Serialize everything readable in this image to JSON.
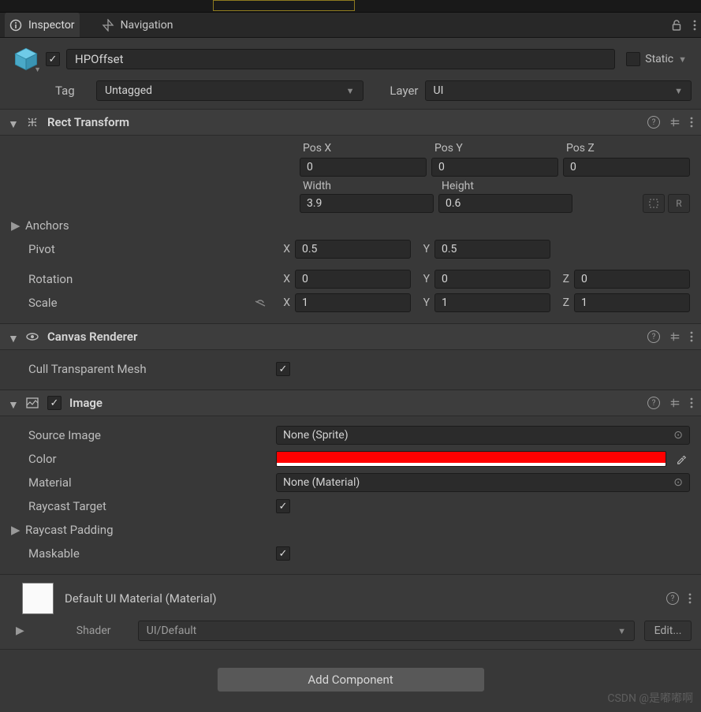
{
  "tabs": {
    "inspector": "Inspector",
    "navigation": "Navigation"
  },
  "header": {
    "name": "HPOffset",
    "enabled": true,
    "static_label": "Static",
    "static_checked": false,
    "tag_label": "Tag",
    "tag_value": "Untagged",
    "layer_label": "Layer",
    "layer_value": "UI"
  },
  "rect_transform": {
    "title": "Rect Transform",
    "posx_label": "Pos X",
    "posx": "0",
    "posy_label": "Pos Y",
    "posy": "0",
    "posz_label": "Pos Z",
    "posz": "0",
    "width_label": "Width",
    "width": "3.9",
    "height_label": "Height",
    "height": "0.6",
    "anchors_label": "Anchors",
    "pivot_label": "Pivot",
    "pivot_x": "0.5",
    "pivot_y": "0.5",
    "rotation_label": "Rotation",
    "rot_x": "0",
    "rot_y": "0",
    "rot_z": "0",
    "scale_label": "Scale",
    "scale_x": "1",
    "scale_y": "1",
    "scale_z": "1",
    "x": "X",
    "y": "Y",
    "z": "Z",
    "r_label": "R"
  },
  "canvas_renderer": {
    "title": "Canvas Renderer",
    "cull_label": "Cull Transparent Mesh",
    "cull_checked": true
  },
  "image": {
    "title": "Image",
    "enabled": true,
    "source_label": "Source Image",
    "source_value": "None (Sprite)",
    "color_label": "Color",
    "color_value": "#ff0000",
    "material_label": "Material",
    "material_value": "None (Material)",
    "raycast_label": "Raycast Target",
    "raycast_checked": true,
    "raycast_padding_label": "Raycast Padding",
    "maskable_label": "Maskable",
    "maskable_checked": true
  },
  "material": {
    "title": "Default UI Material (Material)",
    "shader_label": "Shader",
    "shader_value": "UI/Default",
    "edit_label": "Edit..."
  },
  "footer": {
    "add_component": "Add Component"
  },
  "watermark": "CSDN @是嘟嘟啊"
}
